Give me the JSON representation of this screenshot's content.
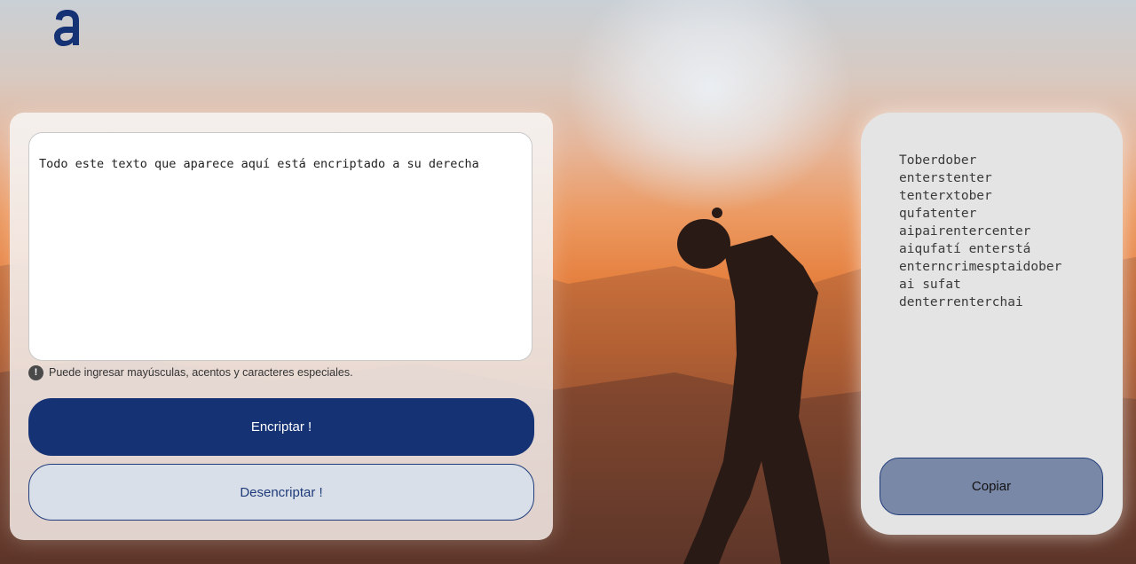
{
  "header": {
    "logo_icon": "alura-logo-icon",
    "brand_color": "#153275"
  },
  "input": {
    "value": "Todo este texto que aparece aquí está encriptado a su derecha"
  },
  "hint": {
    "icon": "exclamation-circle-icon",
    "text": "Puede ingresar mayúsculas, acentos y caracteres especiales."
  },
  "buttons": {
    "encrypt_label": "Encriptar !",
    "decrypt_label": "Desencriptar !",
    "copy_label": "Copiar"
  },
  "output": {
    "text": "Toberdober\nenterstenter\ntenterxtober\nqufatenter\naipairentercenter\naiqufatí enterstá\nenterncrimesptaidober\nai sufat\ndenterrenterchai"
  }
}
